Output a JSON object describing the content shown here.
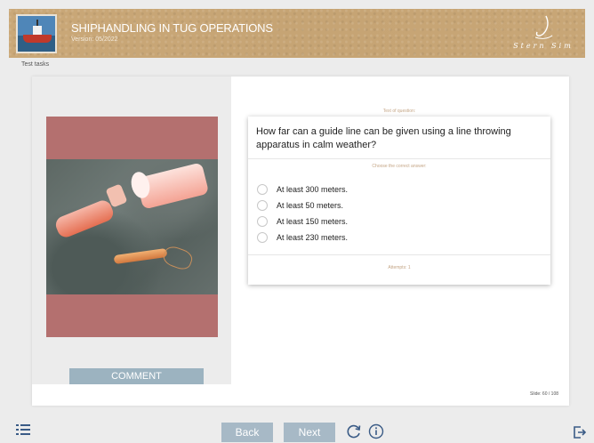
{
  "header": {
    "title": "SHIPHANDLING IN TUG OPERATIONS",
    "version": "Version: 05/2022",
    "brand_text": "Stern Sim",
    "logo_icon": "tugboat-icon",
    "background_color": "#c9a77a"
  },
  "section_label": "Test tasks",
  "question": {
    "caption": "Text of question:",
    "text": "How far can a guide line can be given using a line throwing apparatus in calm weather?",
    "instruction": "Choose the correct answer:",
    "options": [
      "At least 300 meters.",
      "At least 50 meters.",
      "At least 150 meters.",
      "At least 230 meters."
    ],
    "attempts": "Attempts: 1"
  },
  "image": {
    "icon": "line-throwing-apparatus-photo",
    "frame_color": "#b4706f"
  },
  "comment_label": "COMMENT",
  "slide_counter": "Slide: 60 / 108",
  "nav": {
    "back_label": "Back",
    "next_label": "Next",
    "menu_icon": "list-menu-icon",
    "reload_icon": "reload-icon",
    "info_icon": "info-icon",
    "exit_icon": "exit-icon",
    "button_color": "#a7b9c6",
    "icon_color": "#3a5b86"
  }
}
